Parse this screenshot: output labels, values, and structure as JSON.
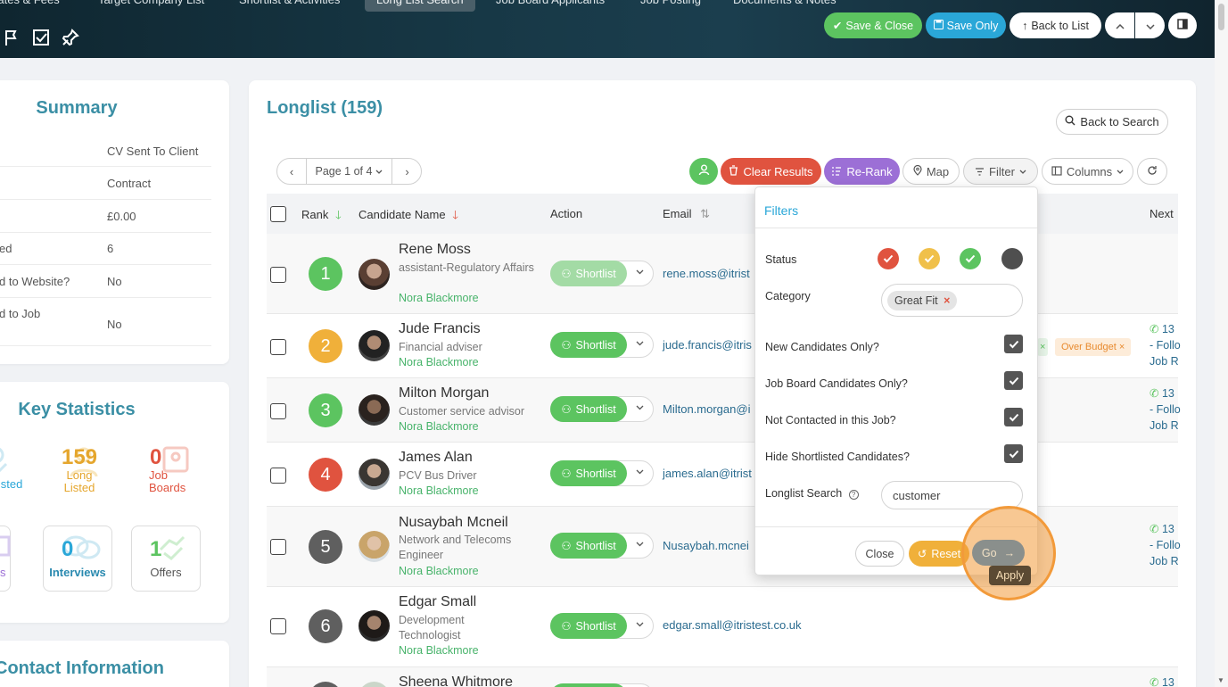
{
  "top_tabs": [
    "Dates & Fees",
    "Target Company List",
    "Shortlist & Activities",
    "Long List Search",
    "Job Board Applicants",
    "Job Posting",
    "Documents & Notes"
  ],
  "toolbar": {
    "save_close": "Save & Close",
    "save_only": "Save Only",
    "back_to_list": "Back to List"
  },
  "summary": {
    "title": "Summary",
    "rows": [
      {
        "label": "",
        "value": "CV Sent To Client"
      },
      {
        "label": "",
        "value": "Contract"
      },
      {
        "label": "",
        "value": "£0.00"
      },
      {
        "label": "ed",
        "value": "6"
      },
      {
        "label": "d to Website?",
        "value": "No"
      },
      {
        "label": "d to Job",
        "value": "No"
      }
    ]
  },
  "key_stats": {
    "title": "Key Statistics",
    "shortlisted_label": "listed",
    "longlisted": {
      "num": "159",
      "label1": "Long",
      "label2": "Listed"
    },
    "jobboards": {
      "num": "0",
      "label1": "Job",
      "label2": "Boards"
    },
    "cv_label": "s",
    "interviews": {
      "num": "0",
      "label": "Interviews"
    },
    "offers": {
      "num": "1",
      "label": "Offers"
    }
  },
  "contact": {
    "title": "Contact Information"
  },
  "longlist": {
    "title": "Longlist (159)",
    "back_to_search": "Back to Search",
    "page_label": "Page 1 of 4",
    "clear_results": "Clear Results",
    "rerank": "Re-Rank",
    "map": "Map",
    "filter": "Filter",
    "columns": "Columns"
  },
  "columns": {
    "rank": "Rank",
    "name": "Candidate Name",
    "action": "Action",
    "email": "Email",
    "next": "Next"
  },
  "shortlist_label": "Shortlist",
  "candidates": [
    {
      "rank": "1",
      "name": "Rene Moss",
      "role": "assistant-Regulatory Affairs",
      "owner": "Nora Blackmore",
      "email": "rene.moss@itrist"
    },
    {
      "rank": "2",
      "name": "Jude Francis",
      "role": "Financial adviser",
      "owner": "Nora Blackmore",
      "email": "jude.francis@itris"
    },
    {
      "rank": "3",
      "name": "Milton Morgan",
      "role": "Customer service advisor",
      "owner": "Nora Blackmore",
      "email": "Milton.morgan@i"
    },
    {
      "rank": "4",
      "name": "James Alan",
      "role": "PCV Bus Driver",
      "owner": "Nora Blackmore",
      "email": "james.alan@itrist"
    },
    {
      "rank": "5",
      "name": "Nusaybah Mcneil",
      "role": "Network and Telecoms Engineer",
      "owner": "Nora Blackmore",
      "email": "Nusaybah.mcnei"
    },
    {
      "rank": "6",
      "name": "Edgar Small",
      "role": "Development Technologist",
      "owner": "Nora Blackmore",
      "email": "edgar.small@itristest.co.uk"
    },
    {
      "rank": "",
      "name": "Sheena Whitmore",
      "role": "",
      "owner": "",
      "email": ""
    }
  ],
  "next_col": {
    "phone": "13",
    "follow": "- Follo",
    "job": "Job R"
  },
  "over_budget": "Over Budget",
  "filters": {
    "title": "Filters",
    "status": "Status",
    "category": "Category",
    "category_tag": "Great Fit",
    "new_only": "New Candidates Only?",
    "job_board_only": "Job Board Candidates Only?",
    "not_contacted": "Not Contacted in this Job?",
    "hide_shortlisted": "Hide Shortlisted Candidates?",
    "longlist_search": "Longlist Search",
    "search_value": "customer",
    "close": "Close",
    "reset": "Reset",
    "go": "Go",
    "tooltip": "Apply"
  },
  "colors": {
    "teal": "#3b8fa5",
    "green": "#5cc460",
    "red": "#e0533f",
    "orange": "#f0b03a",
    "purple": "#9c6fd6",
    "blue": "#2aa7d8",
    "grey": "#5f5f5f",
    "highlight": "#f29a3a"
  }
}
